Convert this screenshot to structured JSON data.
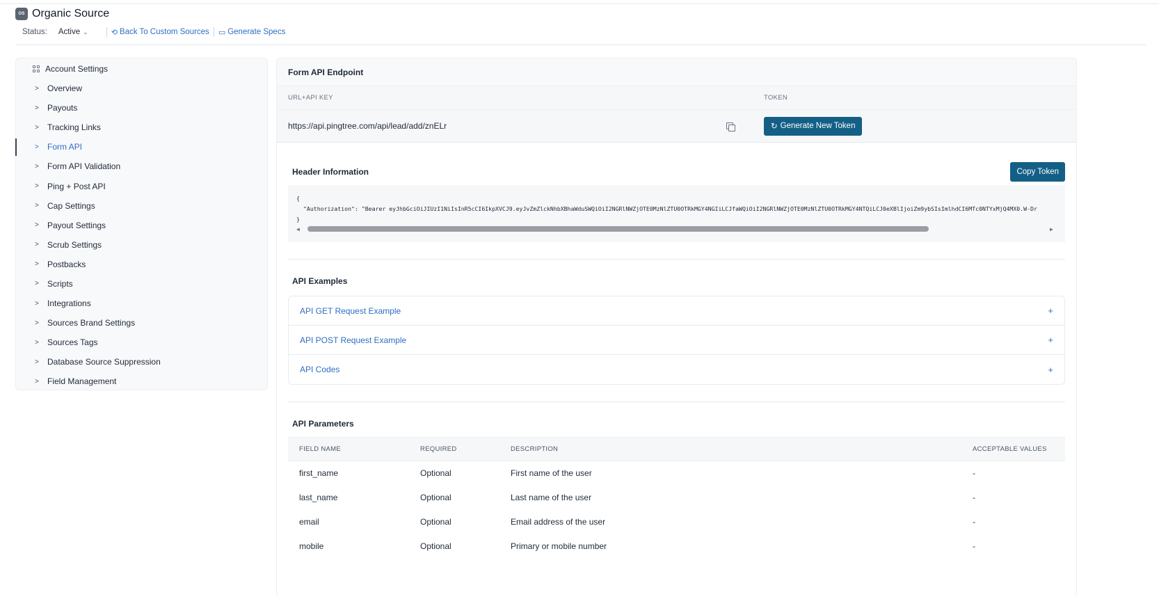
{
  "header": {
    "logo_text": "OS",
    "title": "Organic Source",
    "status_label": "Status:",
    "status_value": "Active",
    "back_link": "Back To Custom Sources",
    "specs_link": "Generate Specs"
  },
  "sidebar": {
    "heading": "Account Settings",
    "items": [
      {
        "label": "Overview"
      },
      {
        "label": "Payouts"
      },
      {
        "label": "Tracking Links"
      },
      {
        "label": "Form API"
      },
      {
        "label": "Form API Validation"
      },
      {
        "label": "Ping + Post API"
      },
      {
        "label": "Cap Settings"
      },
      {
        "label": "Payout Settings"
      },
      {
        "label": "Scrub Settings"
      },
      {
        "label": "Postbacks"
      },
      {
        "label": "Scripts"
      },
      {
        "label": "Integrations"
      },
      {
        "label": "Sources Brand Settings"
      },
      {
        "label": "Sources Tags"
      },
      {
        "label": "Database Source Suppression"
      },
      {
        "label": "Field Management"
      }
    ],
    "active": "Form API"
  },
  "endpoint": {
    "title": "Form API Endpoint",
    "col_url": "URL+API KEY",
    "col_token": "TOKEN",
    "url": "https://api.pingtree.com/api/lead/add/znELr",
    "generate_button": "Generate New Token"
  },
  "header_info": {
    "title": "Header Information",
    "copy_button": "Copy Token",
    "open_brace": "{",
    "line": "\"Authorization\": \"Bearer eyJhbGciOiJIUzI1NiIsInR5cCI6IkpXVCJ9.eyJvZmZlckNhbXBhaWduSWQiOiI2NGRlNWZjOTE0MzNlZTU0OTRkMGY4NGIiLCJfaWQiOiI2NGRlNWZjOTE0MzNlZTU0OTRkMGY4NTQiLCJ0eXBlIjoiZm9ybSIsImlhdCI6MTc0NTYxMjQ4MX0.W-Dr",
    "close_brace": "}"
  },
  "api_examples": {
    "title": "API Examples",
    "items": [
      {
        "label": "API GET Request Example"
      },
      {
        "label": "API POST Request Example"
      },
      {
        "label": "API Codes"
      }
    ]
  },
  "api_parameters": {
    "title": "API Parameters",
    "columns": [
      "FIELD NAME",
      "REQUIRED",
      "DESCRIPTION",
      "ACCEPTABLE VALUES"
    ],
    "rows": [
      {
        "field": "first_name",
        "required": "Optional",
        "description": "First name of the user",
        "values": "-"
      },
      {
        "field": "last_name",
        "required": "Optional",
        "description": "Last name of the user",
        "values": "-"
      },
      {
        "field": "email",
        "required": "Optional",
        "description": "Email address of the user",
        "values": "-"
      },
      {
        "field": "mobile",
        "required": "Optional",
        "description": "Primary or mobile number",
        "values": "-"
      }
    ]
  },
  "colors": {
    "primary_button": "#135f86",
    "link": "#2f6ec4"
  }
}
